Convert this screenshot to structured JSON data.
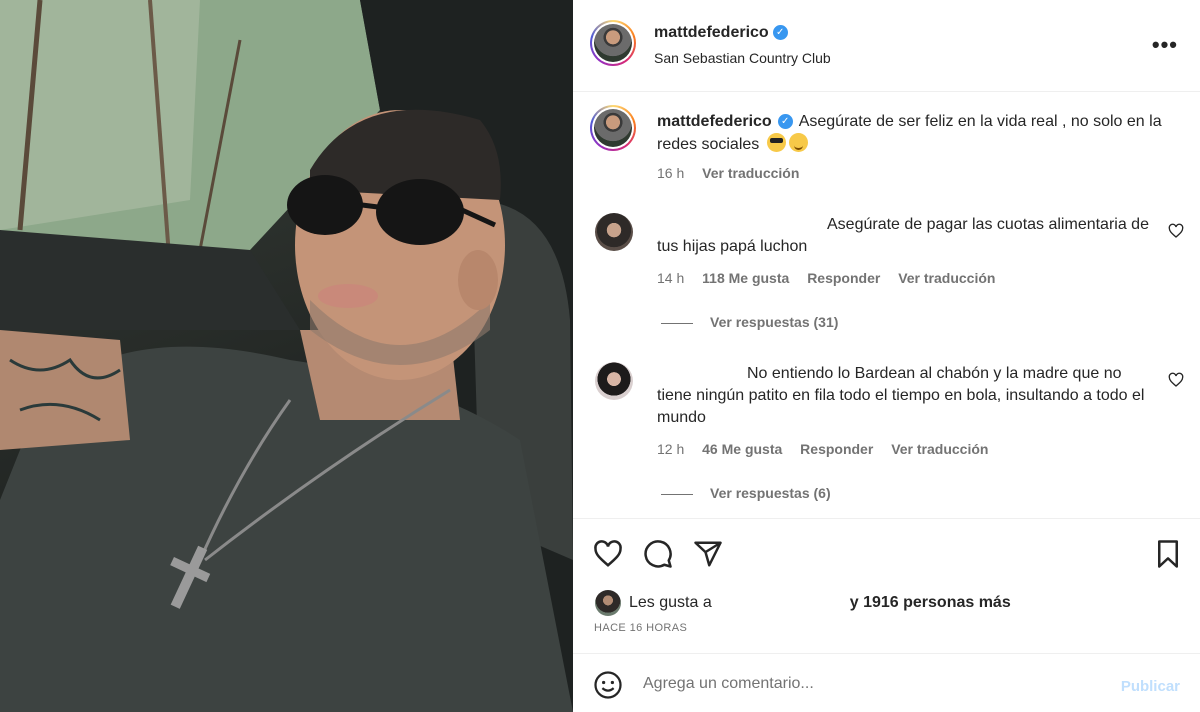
{
  "post": {
    "username": "mattdefederico",
    "location": "San Sebastian Country Club",
    "verified": true
  },
  "caption": {
    "username": "mattdefederico",
    "text": "Asegúrate de ser feliz en la vida real , no solo en la redes sociales",
    "emojis": [
      "smiling-face-with-sunglasses",
      "winking-face"
    ],
    "time": "16 h",
    "translate_label": "Ver traducción"
  },
  "comments": [
    {
      "text": "Asegúrate de pagar las cuotas alimentaria de tus hijas papá luchon",
      "time": "14 h",
      "likes": "118 Me gusta",
      "reply_label": "Responder",
      "translate_label": "Ver traducción",
      "view_replies": "Ver respuestas (31)"
    },
    {
      "text": "No entiendo lo Bardean al chabón y la madre que no tiene ningún patito en fila todo el tiempo en bola, insultando a todo el mundo",
      "time": "12 h",
      "likes": "46 Me gusta",
      "reply_label": "Responder",
      "translate_label": "Ver traducción",
      "view_replies": "Ver respuestas (6)"
    }
  ],
  "likes_line": {
    "prefix": "Les gusta a",
    "suffix": "y 1916 personas más"
  },
  "time_ago": "HACE 16 HORAS",
  "comment_box": {
    "placeholder": "Agrega un comentario...",
    "publish_label": "Publicar"
  },
  "colors": {
    "verified_blue": "#3897f0",
    "publish_disabled": "#c0dffd",
    "secondary_text": "#737373"
  }
}
